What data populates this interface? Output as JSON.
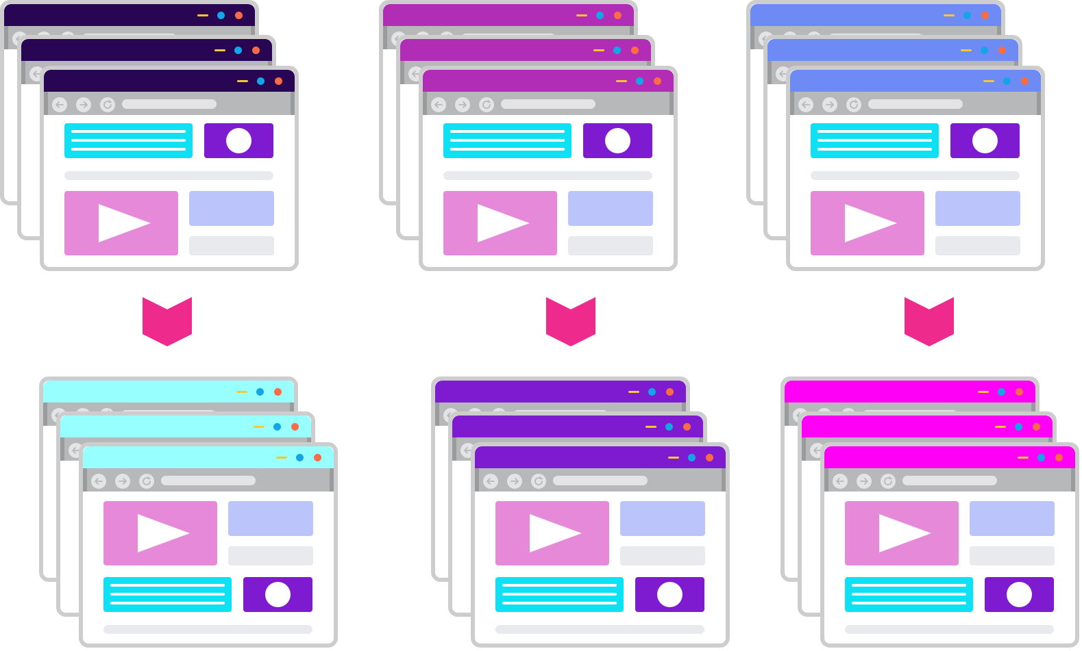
{
  "colors": {
    "frame": "#cdcdcd",
    "nav_bar": "#b7b8ba",
    "nav_button": "#e4e4e6",
    "text_block": "#0fe1f5",
    "image_block": "#7e1ad0",
    "video_block": "#e589d8",
    "side_block": "#bcc4fc",
    "placeholder": "#e8eaed",
    "minimize": "#ffc72e",
    "dot_blue": "#13a6e6",
    "dot_orange": "#fb6b44",
    "arrow": "#ef2a8d"
  },
  "icons": {
    "back": "arrow-left-icon",
    "forward": "arrow-right-icon",
    "reload": "reload-icon",
    "play": "play-icon",
    "flow": "chevron-down-arrow-icon"
  },
  "stacks": [
    {
      "id": "source-1",
      "title_color": "#290654",
      "layout": "text-first"
    },
    {
      "id": "source-2",
      "title_color": "#b22db6",
      "layout": "text-first"
    },
    {
      "id": "source-3",
      "title_color": "#6e8bf5",
      "layout": "text-first"
    },
    {
      "id": "result-1",
      "title_color": "#98ffff",
      "layout": "video-first"
    },
    {
      "id": "result-2",
      "title_color": "#7e1ad0",
      "layout": "video-first"
    },
    {
      "id": "result-3",
      "title_color": "#ff00f7",
      "layout": "video-first"
    }
  ]
}
